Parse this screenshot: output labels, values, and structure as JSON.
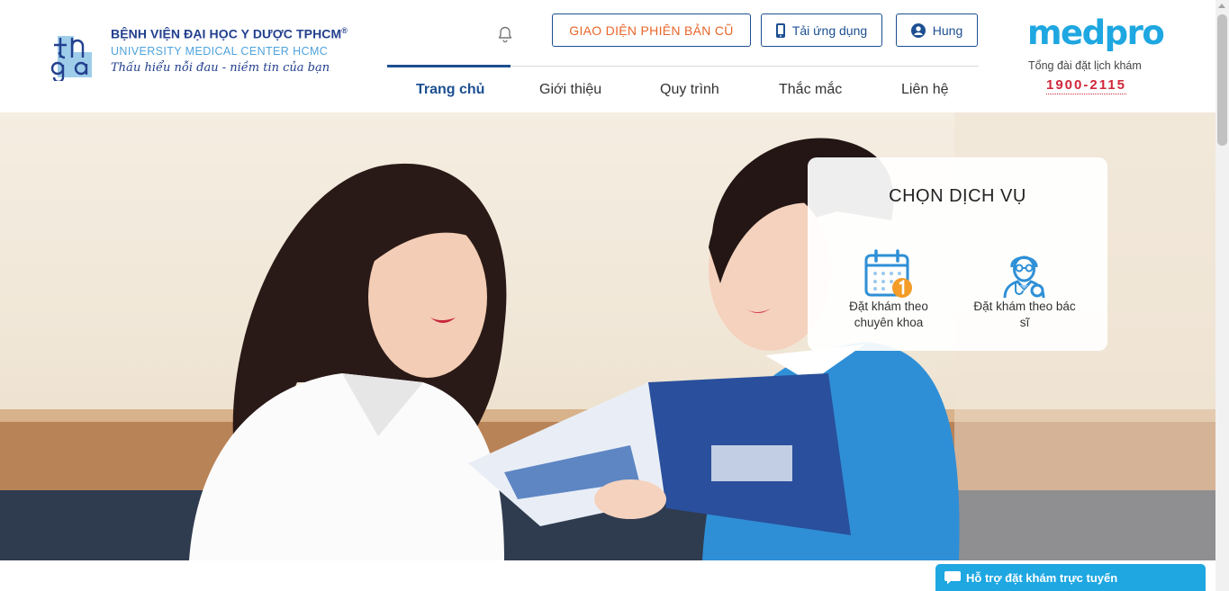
{
  "header": {
    "hospital": {
      "name_vn": "BỆNH VIỆN ĐẠI HỌC Y DƯỢC TPHCM",
      "registered_mark": "®",
      "name_en": "UNIVERSITY MEDICAL CENTER HCMC",
      "slogan": "Thấu hiểu nỗi đau - niềm tin của bạn",
      "logo_icon": "umc-logo-icon"
    },
    "notification_icon": "bell-icon",
    "buttons": {
      "old_interface": "GIAO DIỆN PHIÊN BẢN CŨ",
      "download_app": "Tải ứng dụng",
      "user": "Hung"
    },
    "nav": [
      {
        "label": "Trang chủ",
        "active": true
      },
      {
        "label": "Giới thiệu",
        "active": false
      },
      {
        "label": "Quy trình",
        "active": false
      },
      {
        "label": "Thắc mắc",
        "active": false
      },
      {
        "label": "Liên hệ",
        "active": false
      }
    ],
    "medpro": {
      "brand": "medpro",
      "hotline_label": "Tổng đài đặt lịch khám",
      "hotline_number": "1900-2115"
    }
  },
  "service_card": {
    "title": "CHỌN DỊCH VỤ",
    "services": [
      {
        "label": "Đặt khám theo chuyên khoa",
        "icon": "calendar-icon"
      },
      {
        "label": "Đặt khám theo bác sĩ",
        "icon": "doctor-icon"
      }
    ]
  },
  "chat": {
    "label": "Hỗ trợ đặt khám trực tuyến",
    "icon": "chat-bubble-icon"
  },
  "colors": {
    "primary": "#1c4f91",
    "accent_orange": "#e8662a",
    "medpro_blue": "#1ea7e1",
    "hotline_red": "#d0273a"
  }
}
